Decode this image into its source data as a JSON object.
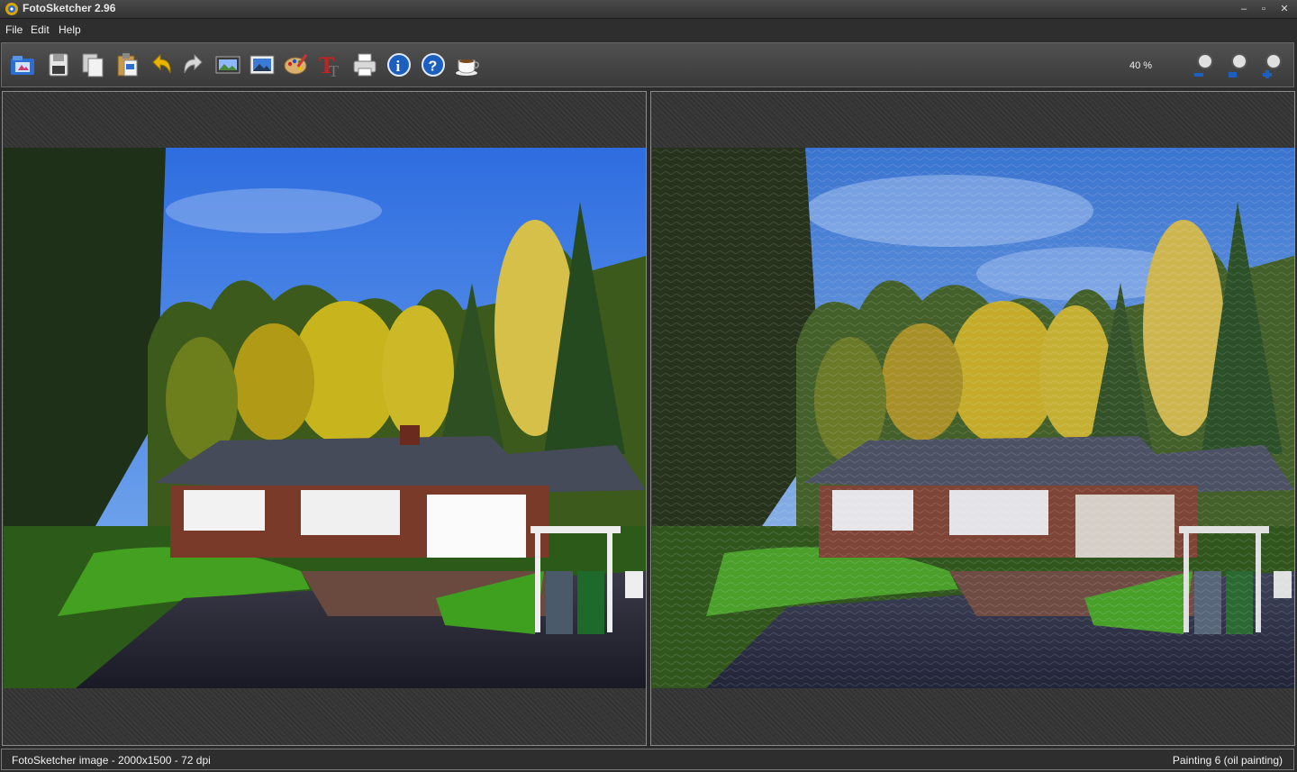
{
  "window": {
    "title": "FotoSketcher 2.96",
    "controls": {
      "minimize": "–",
      "restore": "▫",
      "close": "✕"
    }
  },
  "menu": {
    "items": [
      "File",
      "Edit",
      "Help"
    ]
  },
  "toolbar": {
    "buttons": [
      {
        "name": "open-icon"
      },
      {
        "name": "save-icon"
      },
      {
        "name": "copy-icon"
      },
      {
        "name": "paste-icon"
      },
      {
        "name": "undo-icon"
      },
      {
        "name": "redo-icon"
      },
      {
        "name": "batch-icon"
      },
      {
        "name": "frame-icon"
      },
      {
        "name": "palette-icon"
      },
      {
        "name": "text-icon"
      },
      {
        "name": "print-icon"
      },
      {
        "name": "info-icon"
      },
      {
        "name": "help-icon"
      },
      {
        "name": "donate-icon"
      }
    ],
    "zoom_level": "40 %",
    "zoom_buttons": [
      {
        "name": "zoom-out-icon"
      },
      {
        "name": "zoom-actual-icon"
      },
      {
        "name": "zoom-in-icon"
      }
    ]
  },
  "colors": {
    "accent_icon_blue": "#1d5fbf",
    "text_red": "#cc2020",
    "undo_yellow": "#e8b400"
  },
  "status": {
    "left": "FotoSketcher image - 2000x1500 - 72 dpi",
    "right": "Painting 6 (oil painting)"
  }
}
